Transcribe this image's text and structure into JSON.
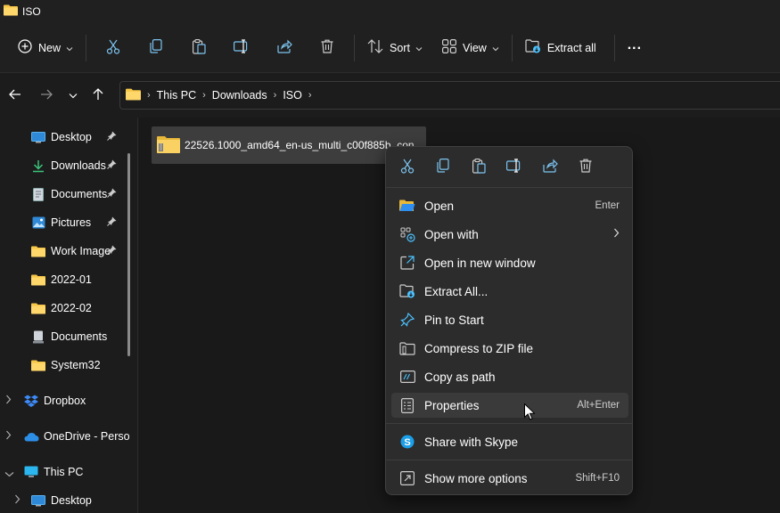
{
  "window": {
    "title": "ISO"
  },
  "toolbar": {
    "new_label": "New",
    "sort_label": "Sort",
    "view_label": "View",
    "extract_label": "Extract all",
    "more": "..."
  },
  "address": {
    "crumbs": [
      "This PC",
      "Downloads",
      "ISO"
    ]
  },
  "sidebar": {
    "items": [
      {
        "label": "Desktop",
        "icon": "desktop-icon",
        "pinned": true
      },
      {
        "label": "Downloads",
        "icon": "download-icon",
        "pinned": true
      },
      {
        "label": "Documents",
        "icon": "document-icon",
        "pinned": true
      },
      {
        "label": "Pictures",
        "icon": "pictures-icon",
        "pinned": true
      },
      {
        "label": "Work Image",
        "icon": "folder-icon",
        "pinned": true
      },
      {
        "label": "2022-01",
        "icon": "folder-icon",
        "pinned": false
      },
      {
        "label": "2022-02",
        "icon": "folder-icon",
        "pinned": false
      },
      {
        "label": "Documents",
        "icon": "computer-docs-icon",
        "pinned": false
      },
      {
        "label": "System32",
        "icon": "folder-icon",
        "pinned": false
      },
      {
        "label": "Dropbox",
        "icon": "dropbox-icon"
      },
      {
        "label": "OneDrive - Perso",
        "icon": "onedrive-icon"
      },
      {
        "label": "This PC",
        "icon": "monitor-icon"
      },
      {
        "label": "Desktop",
        "icon": "desktop-icon"
      }
    ]
  },
  "content": {
    "file_name": "22526.1000_amd64_en-us_multi_c00f885b_con"
  },
  "context_menu": {
    "items": [
      {
        "label": "Open",
        "shortcut": "Enter"
      },
      {
        "label": "Open with",
        "shortcut": ""
      },
      {
        "label": "Open in new window",
        "shortcut": ""
      },
      {
        "label": "Extract All...",
        "shortcut": ""
      },
      {
        "label": "Pin to Start",
        "shortcut": ""
      },
      {
        "label": "Compress to ZIP file",
        "shortcut": ""
      },
      {
        "label": "Copy as path",
        "shortcut": ""
      },
      {
        "label": "Properties",
        "shortcut": "Alt+Enter"
      },
      {
        "label": "Share with Skype",
        "shortcut": ""
      },
      {
        "label": "Show more options",
        "shortcut": "Shift+F10"
      }
    ]
  },
  "colors": {
    "accent": "#4cc2ff",
    "folder": "#f7c748",
    "background": "#1c1c1c",
    "menu": "#2c2c2c"
  }
}
